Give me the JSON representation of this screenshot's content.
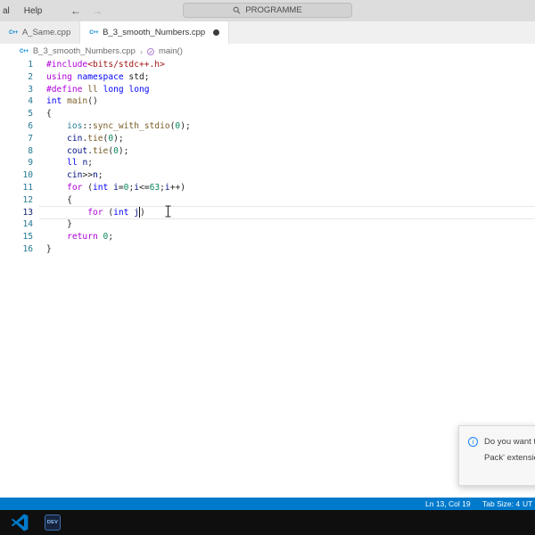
{
  "title_bar": {
    "menus": [
      {
        "label": "al"
      },
      {
        "label": "Help"
      }
    ],
    "nav_back": "←",
    "nav_forward": "→",
    "command_center": {
      "label": "PROGRAMME"
    }
  },
  "tabs": [
    {
      "label": "A_Same.cpp",
      "icon": "C++",
      "active": false,
      "modified": false
    },
    {
      "label": "B_3_smooth_Numbers.cpp",
      "icon": "C++",
      "active": true,
      "modified": true
    }
  ],
  "breadcrumb": {
    "file_icon": "C++",
    "file": "B_3_smooth_Numbers.cpp",
    "separator": "›",
    "symbol": "main()"
  },
  "editor": {
    "active_line": 13,
    "colors": {
      "directive": "#AF00DB",
      "keyword": "#0000FF",
      "type": "#267F99",
      "func": "#795E26",
      "number": "#098658",
      "variable": "#001080",
      "string": "#A31515",
      "plain": "#1F1F1F"
    },
    "lines": [
      {
        "num": 1,
        "segs": [
          [
            "#include",
            "directive"
          ],
          [
            "<bits/stdc++.h>",
            "string"
          ]
        ]
      },
      {
        "num": 2,
        "segs": [
          [
            "using",
            "directive"
          ],
          [
            " ",
            "plain"
          ],
          [
            "namespace",
            "keyword"
          ],
          [
            " std;",
            "plain"
          ]
        ]
      },
      {
        "num": 3,
        "segs": [
          [
            "#define",
            "directive"
          ],
          [
            " ",
            "plain"
          ],
          [
            "ll",
            "func"
          ],
          [
            " ",
            "plain"
          ],
          [
            "long long",
            "keyword"
          ]
        ]
      },
      {
        "num": 4,
        "segs": [
          [
            "int",
            "keyword"
          ],
          [
            " ",
            "plain"
          ],
          [
            "main",
            "func"
          ],
          [
            "()",
            "plain"
          ]
        ]
      },
      {
        "num": 5,
        "segs": [
          [
            "{",
            "plain"
          ]
        ]
      },
      {
        "num": 6,
        "segs": [
          [
            "    ",
            "plain"
          ],
          [
            "ios",
            "type"
          ],
          [
            "::",
            "plain"
          ],
          [
            "sync_with_stdio",
            "func"
          ],
          [
            "(",
            "plain"
          ],
          [
            "0",
            "number"
          ],
          [
            ");",
            "plain"
          ]
        ]
      },
      {
        "num": 7,
        "segs": [
          [
            "    ",
            "plain"
          ],
          [
            "cin",
            "variable"
          ],
          [
            ".",
            "plain"
          ],
          [
            "tie",
            "func"
          ],
          [
            "(",
            "plain"
          ],
          [
            "0",
            "number"
          ],
          [
            ");",
            "plain"
          ]
        ]
      },
      {
        "num": 8,
        "segs": [
          [
            "    ",
            "plain"
          ],
          [
            "cout",
            "variable"
          ],
          [
            ".",
            "plain"
          ],
          [
            "tie",
            "func"
          ],
          [
            "(",
            "plain"
          ],
          [
            "0",
            "number"
          ],
          [
            ");",
            "plain"
          ]
        ]
      },
      {
        "num": 9,
        "segs": [
          [
            "    ",
            "plain"
          ],
          [
            "ll",
            "keyword"
          ],
          [
            " ",
            "plain"
          ],
          [
            "n",
            "variable"
          ],
          [
            ";",
            "plain"
          ]
        ]
      },
      {
        "num": 10,
        "segs": [
          [
            "    ",
            "plain"
          ],
          [
            "cin",
            "variable"
          ],
          [
            ">>",
            "plain"
          ],
          [
            "n",
            "variable"
          ],
          [
            ";",
            "plain"
          ]
        ]
      },
      {
        "num": 11,
        "segs": [
          [
            "    ",
            "plain"
          ],
          [
            "for",
            "directive"
          ],
          [
            " (",
            "plain"
          ],
          [
            "int",
            "keyword"
          ],
          [
            " ",
            "plain"
          ],
          [
            "i",
            "variable"
          ],
          [
            "=",
            "plain"
          ],
          [
            "0",
            "number"
          ],
          [
            ";",
            "plain"
          ],
          [
            "i",
            "variable"
          ],
          [
            "<=",
            "plain"
          ],
          [
            "63",
            "number"
          ],
          [
            ";",
            "plain"
          ],
          [
            "i",
            "variable"
          ],
          [
            "++)",
            "plain"
          ]
        ]
      },
      {
        "num": 12,
        "segs": [
          [
            "    {",
            "plain"
          ]
        ]
      },
      {
        "num": 13,
        "segs": [
          [
            "        ",
            "plain"
          ],
          [
            "for",
            "directive"
          ],
          [
            " (",
            "plain"
          ],
          [
            "int",
            "keyword"
          ],
          [
            " ",
            "plain"
          ],
          [
            "j",
            "variable"
          ],
          [
            "",
            "caret"
          ],
          [
            ")",
            "plain"
          ]
        ]
      },
      {
        "num": 14,
        "segs": [
          [
            "    }",
            "plain"
          ]
        ]
      },
      {
        "num": 15,
        "segs": [
          [
            "    ",
            "plain"
          ],
          [
            "return",
            "directive"
          ],
          [
            " ",
            "plain"
          ],
          [
            "0",
            "number"
          ],
          [
            ";",
            "plain"
          ]
        ]
      },
      {
        "num": 16,
        "segs": [
          [
            "}",
            "plain"
          ]
        ]
      }
    ]
  },
  "notification": {
    "line1": "Do you want to i",
    "line2": "Pack' extension f"
  },
  "status_bar": {
    "items": [
      {
        "label": "Ln 13, Col 19"
      },
      {
        "label": "Tab Size: 4"
      },
      {
        "label": "UT"
      }
    ]
  },
  "taskbar": {
    "icons": [
      {
        "name": "vscode"
      },
      {
        "name": "dev-cpp",
        "label": "DEV"
      }
    ]
  }
}
